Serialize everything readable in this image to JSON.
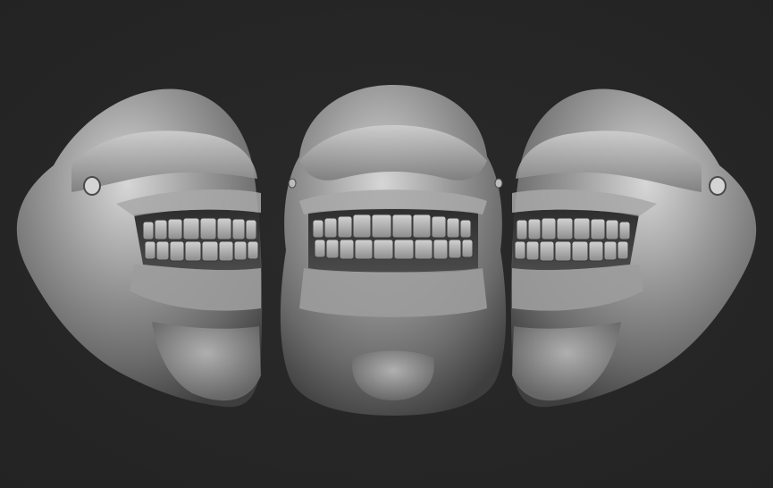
{
  "scene": {
    "background_color": "#262626",
    "clay_base_color": "#8e8e8e",
    "clay_highlight_color": "#d8d8d8",
    "clay_shadow_color": "#3a3a3a",
    "views": [
      {
        "name": "left-three-quarter-view",
        "facing": "left"
      },
      {
        "name": "front-view",
        "facing": "front"
      },
      {
        "name": "right-three-quarter-view",
        "facing": "right"
      }
    ]
  }
}
